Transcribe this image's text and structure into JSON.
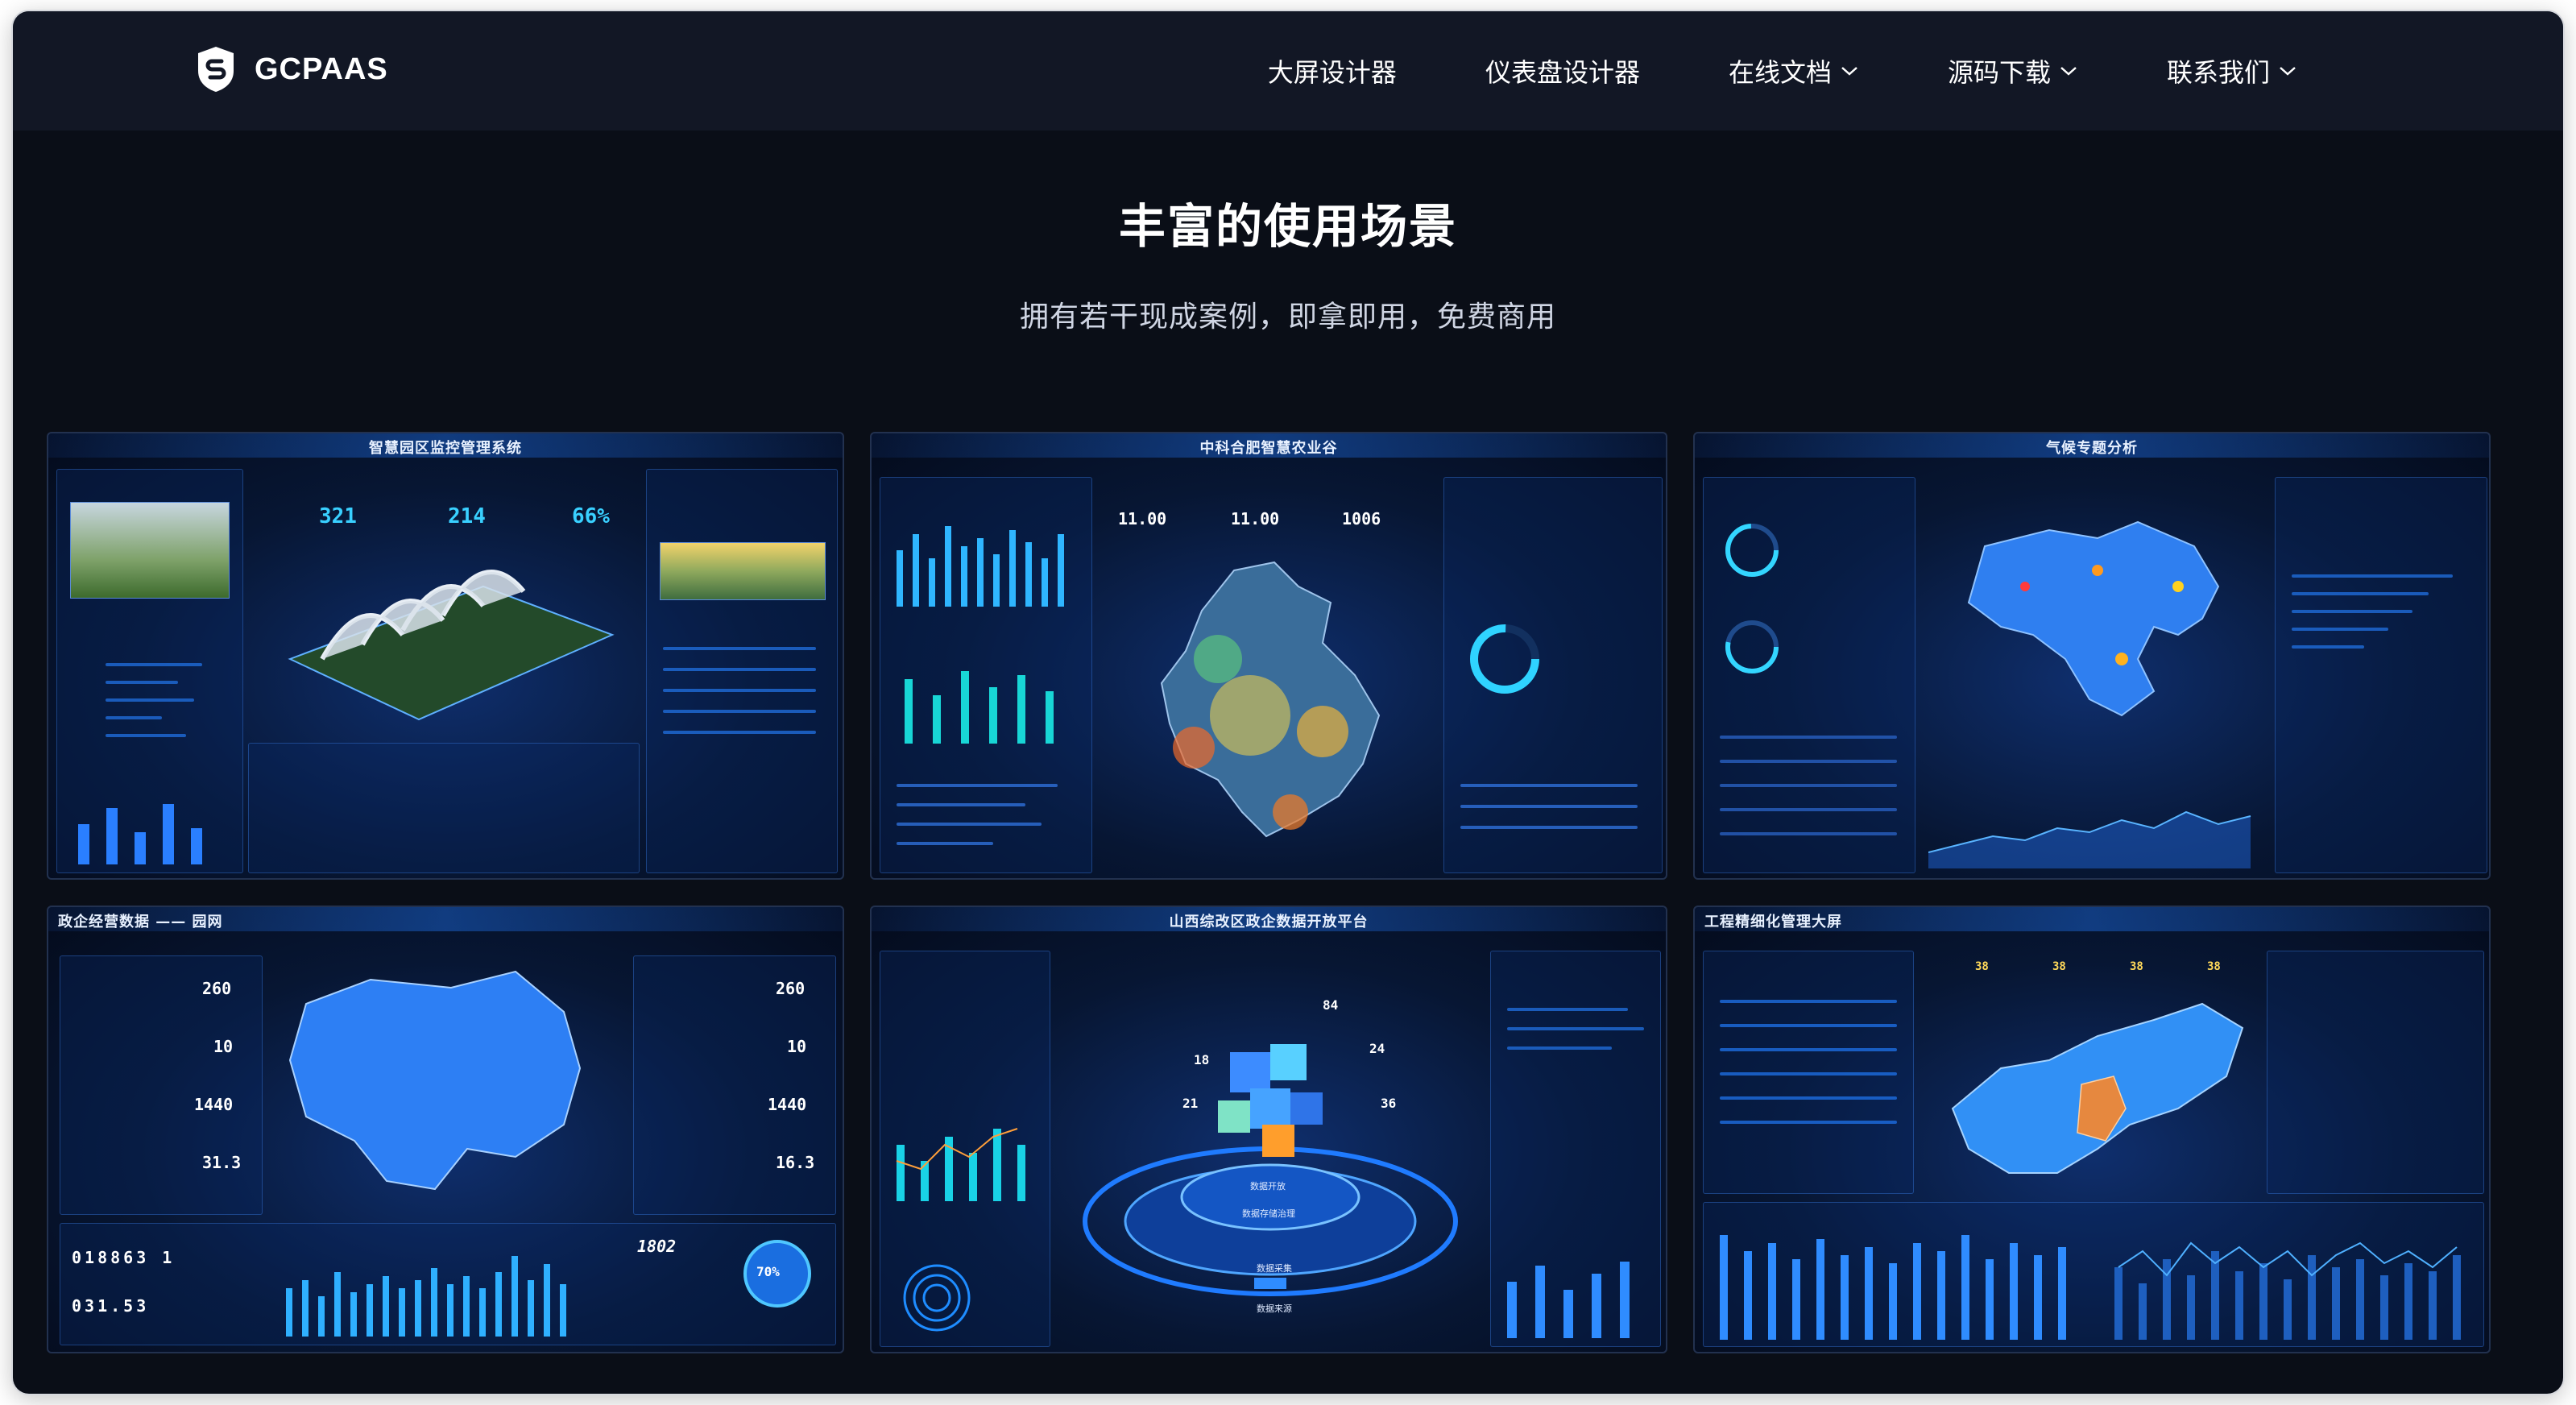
{
  "brand": {
    "name": "GCPAAS",
    "logo_icon": "shield-s-icon"
  },
  "nav": [
    {
      "label": "大屏设计器",
      "has_dropdown": false
    },
    {
      "label": "仪表盘设计器",
      "has_dropdown": false
    },
    {
      "label": "在线文档",
      "has_dropdown": true
    },
    {
      "label": "源码下载",
      "has_dropdown": true
    },
    {
      "label": "联系我们",
      "has_dropdown": true
    }
  ],
  "hero": {
    "title": "丰富的使用场景",
    "subtitle": "拥有若干现成案例，即拿即用，免费商用"
  },
  "cases": [
    {
      "title": "智慧园区监控管理系统",
      "stats": [
        "321",
        "214",
        "66%"
      ]
    },
    {
      "title": "中科合肥智慧农业谷",
      "stats": [
        "11.00",
        "11.00",
        "1006"
      ]
    },
    {
      "title": "气候专题分析"
    },
    {
      "title": "政企经营数据 —— 园网",
      "stats": [
        "260",
        "10",
        "1440",
        "31.3"
      ],
      "stats_right": [
        "260",
        "10",
        "1440",
        "16.3"
      ],
      "counter1": "018863 1",
      "counter2": "031.53",
      "big_num": "1802",
      "gauge": "70%"
    },
    {
      "title": "山西综改区政企数据开放平台",
      "stats": [
        "84",
        "24",
        "18",
        "21",
        "36"
      ],
      "labels": [
        "数据开放",
        "数据存储治理",
        "数据采集",
        "数据来源"
      ]
    },
    {
      "title": "工程精细化管理大屏",
      "stats": [
        "38",
        "38",
        "38",
        "38"
      ]
    }
  ],
  "colors": {
    "bg": "#0a0e17",
    "navbar": "#121725",
    "accent": "#2f8cff",
    "highlight": "#39d0ff"
  }
}
